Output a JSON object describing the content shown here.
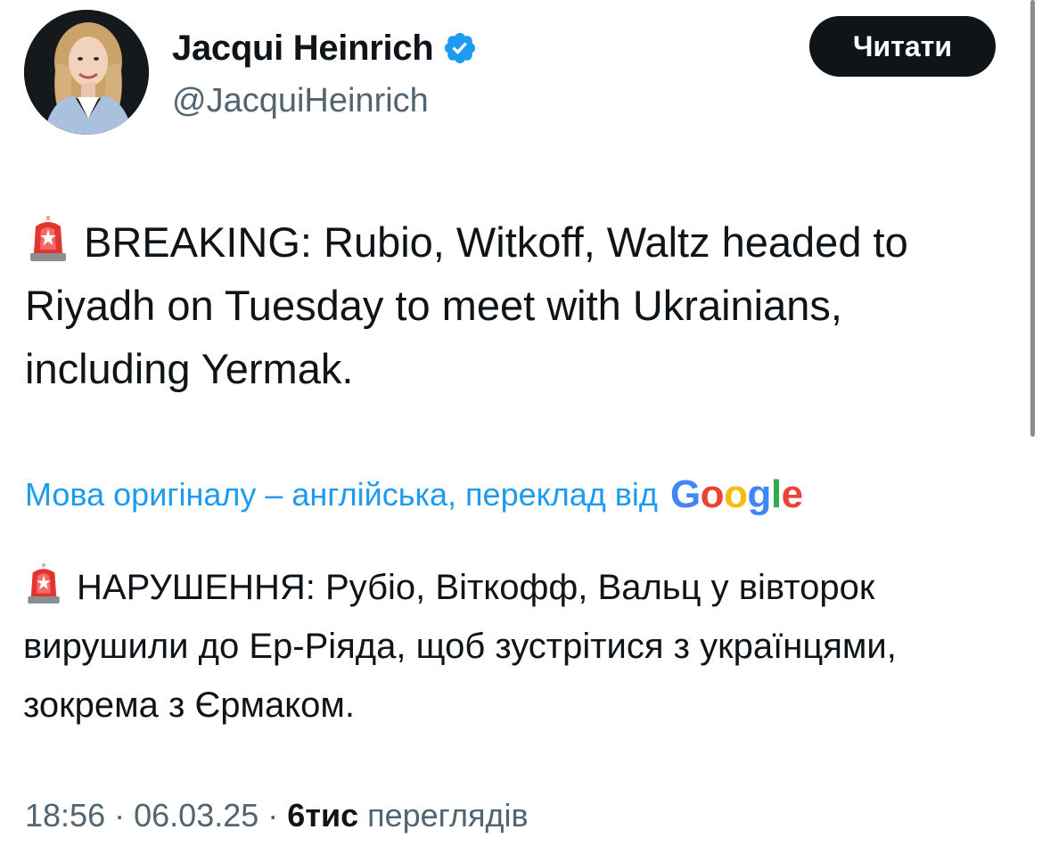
{
  "author": {
    "name": "Jacqui Heinrich",
    "handle": "@JacquiHeinrich",
    "verified": true
  },
  "follow_button": {
    "label": "Читати"
  },
  "tweet": {
    "text": "BREAKING: Rubio, Witkoff, Waltz headed to Riyadh on Tuesday to meet with Ukrainians, including Yermak.",
    "emoji_icon": "police-car-light-icon"
  },
  "translation": {
    "note": "Мова оригіналу – англійська, переклад від",
    "provider": "Google",
    "text": "НАРУШЕННЯ: Рубіо, Віткофф, Вальц у вівторок вирушили до Ер-Ріяда, щоб зустрітися з українцями, зокрема з Єрмаком."
  },
  "meta": {
    "time": "18:56",
    "separator": "·",
    "date": "06.03.25",
    "views_count": "6тис",
    "views_label": "переглядів"
  },
  "colors": {
    "link": "#1d9bf0",
    "secondary_text": "#536471",
    "verified": "#1d9bf0",
    "button_bg": "#0f1419"
  }
}
